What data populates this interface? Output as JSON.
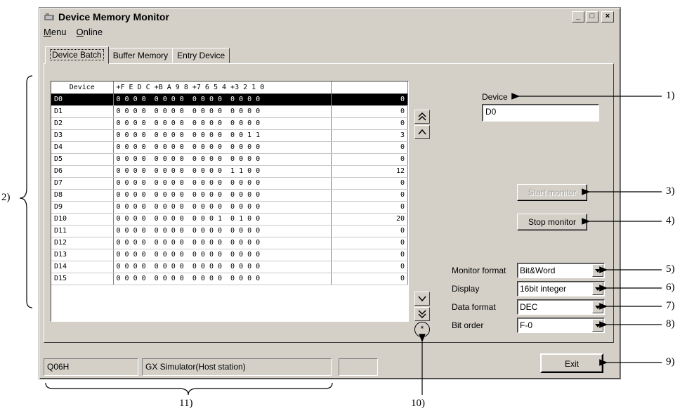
{
  "window": {
    "title": "Device Memory Monitor",
    "buttons": [
      "_",
      "□",
      "×"
    ]
  },
  "menu": [
    {
      "label": "Menu",
      "underline": "M",
      "rest": "enu"
    },
    {
      "label": "Online",
      "underline": "O",
      "rest": "nline"
    }
  ],
  "tabs": [
    {
      "label": "Device Batch",
      "active": true
    },
    {
      "label": "Buffer Memory",
      "active": false
    },
    {
      "label": "Entry Device",
      "active": false
    }
  ],
  "grid": {
    "headers": [
      "Device",
      "+F E D C +B A 9 8 +7 6 5 4 +3 2 1 0",
      ""
    ],
    "rows": [
      {
        "device": "D0",
        "bits": "0 0 0 0  0 0 0 0  0 0 0 0  0 0 0 0",
        "value": "0",
        "selected": true
      },
      {
        "device": "D1",
        "bits": "0 0 0 0  0 0 0 0  0 0 0 0  0 0 0 0",
        "value": "0"
      },
      {
        "device": "D2",
        "bits": "0 0 0 0  0 0 0 0  0 0 0 0  0 0 0 0",
        "value": "0"
      },
      {
        "device": "D3",
        "bits": "0 0 0 0  0 0 0 0  0 0 0 0  0 0 1 1",
        "value": "3"
      },
      {
        "device": "D4",
        "bits": "0 0 0 0  0 0 0 0  0 0 0 0  0 0 0 0",
        "value": "0"
      },
      {
        "device": "D5",
        "bits": "0 0 0 0  0 0 0 0  0 0 0 0  0 0 0 0",
        "value": "0"
      },
      {
        "device": "D6",
        "bits": "0 0 0 0  0 0 0 0  0 0 0 0  1 1 0 0",
        "value": "12"
      },
      {
        "device": "D7",
        "bits": "0 0 0 0  0 0 0 0  0 0 0 0  0 0 0 0",
        "value": "0"
      },
      {
        "device": "D8",
        "bits": "0 0 0 0  0 0 0 0  0 0 0 0  0 0 0 0",
        "value": "0"
      },
      {
        "device": "D9",
        "bits": "0 0 0 0  0 0 0 0  0 0 0 0  0 0 0 0",
        "value": "0"
      },
      {
        "device": "D10",
        "bits": "0 0 0 0  0 0 0 0  0 0 0 1  0 1 0 0",
        "value": "20"
      },
      {
        "device": "D11",
        "bits": "0 0 0 0  0 0 0 0  0 0 0 0  0 0 0 0",
        "value": "0"
      },
      {
        "device": "D12",
        "bits": "0 0 0 0  0 0 0 0  0 0 0 0  0 0 0 0",
        "value": "0"
      },
      {
        "device": "D13",
        "bits": "0 0 0 0  0 0 0 0  0 0 0 0  0 0 0 0",
        "value": "0"
      },
      {
        "device": "D14",
        "bits": "0 0 0 0  0 0 0 0  0 0 0 0  0 0 0 0",
        "value": "0"
      },
      {
        "device": "D15",
        "bits": "0 0 0 0  0 0 0 0  0 0 0 0  0 0 0 0",
        "value": "0"
      }
    ]
  },
  "scroll": {
    "circle_label": "*"
  },
  "device": {
    "label": "Device",
    "value": "D0"
  },
  "buttons": {
    "start_monitor": "Start monitor",
    "stop_monitor": "Stop monitor",
    "exit": "Exit"
  },
  "settings": {
    "monitor_format": {
      "label": "Monitor format",
      "value": "Bit&Word"
    },
    "display": {
      "label": "Display",
      "value": "16bit integer"
    },
    "data_format": {
      "label": "Data format",
      "value": "DEC"
    },
    "bit_order": {
      "label": "Bit order",
      "value": "F-0"
    }
  },
  "status": {
    "cpu": "Q06H",
    "connection": "GX Simulator(Host station)",
    "extra": ""
  },
  "annotations": [
    "1)",
    "2)",
    "3)",
    "4)",
    "5)",
    "6)",
    "7)",
    "8)",
    "9)",
    "10)",
    "11)"
  ]
}
